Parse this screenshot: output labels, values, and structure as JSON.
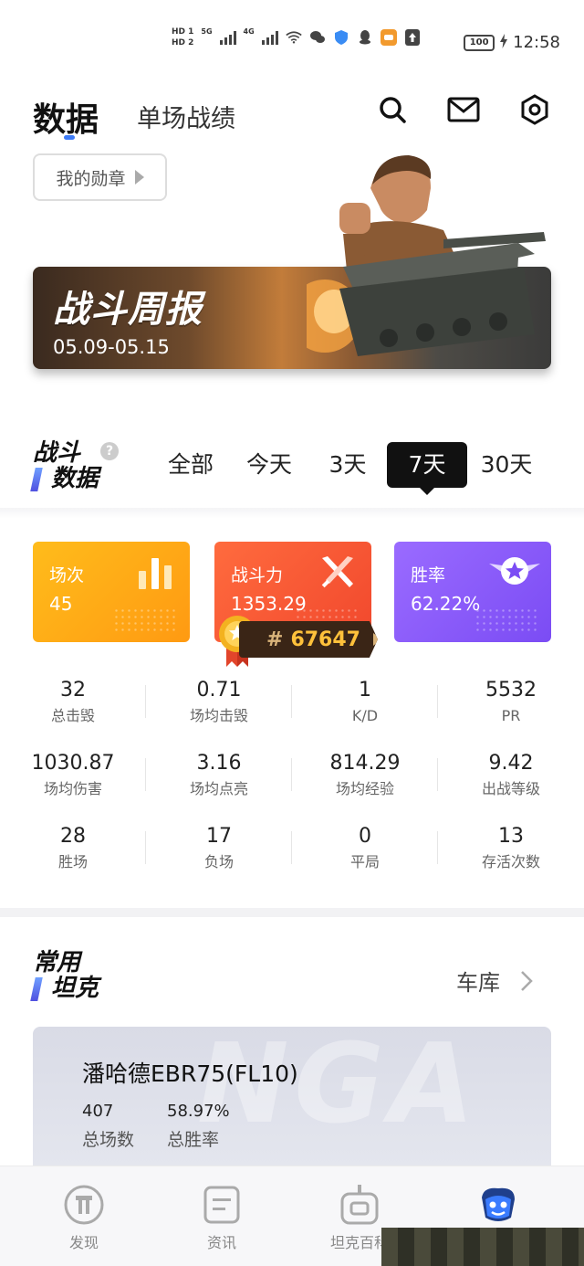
{
  "status_bar": {
    "hd1": "HD 1",
    "hd2": "HD 2",
    "sig1": "5G",
    "sig2": "4G",
    "battery": "100",
    "time": "12:58"
  },
  "header": {
    "tab_data": "数据",
    "tab_single": "单场战绩",
    "icons": [
      "search-icon",
      "mail-icon",
      "settings-icon"
    ]
  },
  "medal_button": {
    "label": "我的勋章"
  },
  "banner": {
    "title": "战斗周报",
    "date": "05.09-05.15"
  },
  "battle_section": {
    "title_line1": "战斗",
    "title_line2": "数据",
    "help": "?",
    "filters": [
      "全部",
      "今天",
      "3天",
      "7天",
      "30天"
    ],
    "active_filter": "7天"
  },
  "cards": [
    {
      "label": "场次",
      "value": "45",
      "color": "#ffa515"
    },
    {
      "label": "战斗力",
      "value": "1353.29",
      "color": "#f5552f"
    },
    {
      "label": "胜率",
      "value": "62.22%",
      "color": "#8a5af8"
    }
  ],
  "rank": {
    "hash": "#",
    "number": "67647"
  },
  "stats": [
    [
      {
        "v": "32",
        "l": "总击毁"
      },
      {
        "v": "0.71",
        "l": "场均击毁"
      },
      {
        "v": "1",
        "l": "K/D"
      },
      {
        "v": "5532",
        "l": "PR"
      }
    ],
    [
      {
        "v": "1030.87",
        "l": "场均伤害"
      },
      {
        "v": "3.16",
        "l": "场均点亮"
      },
      {
        "v": "814.29",
        "l": "场均经验"
      },
      {
        "v": "9.42",
        "l": "出战等级"
      }
    ],
    [
      {
        "v": "28",
        "l": "胜场"
      },
      {
        "v": "17",
        "l": "负场"
      },
      {
        "v": "0",
        "l": "平局"
      },
      {
        "v": "13",
        "l": "存活次数"
      }
    ]
  ],
  "tanks_section": {
    "title_line1": "常用",
    "title_line2": "坦克",
    "garage_label": "车库"
  },
  "tank_card": {
    "watermark": "NGA",
    "name": "潘哈德EBR75(FL10)",
    "battles_value": "407",
    "battles_label": "总场数",
    "winrate_value": "58.97%",
    "winrate_label": "总胜率"
  },
  "bottom_nav": [
    {
      "label": "发现",
      "icon": "discover-icon"
    },
    {
      "label": "资讯",
      "icon": "news-icon"
    },
    {
      "label": "坦克百科",
      "icon": "tank-wiki-icon"
    },
    {
      "label": "",
      "icon": "profile-mascot-icon"
    }
  ]
}
